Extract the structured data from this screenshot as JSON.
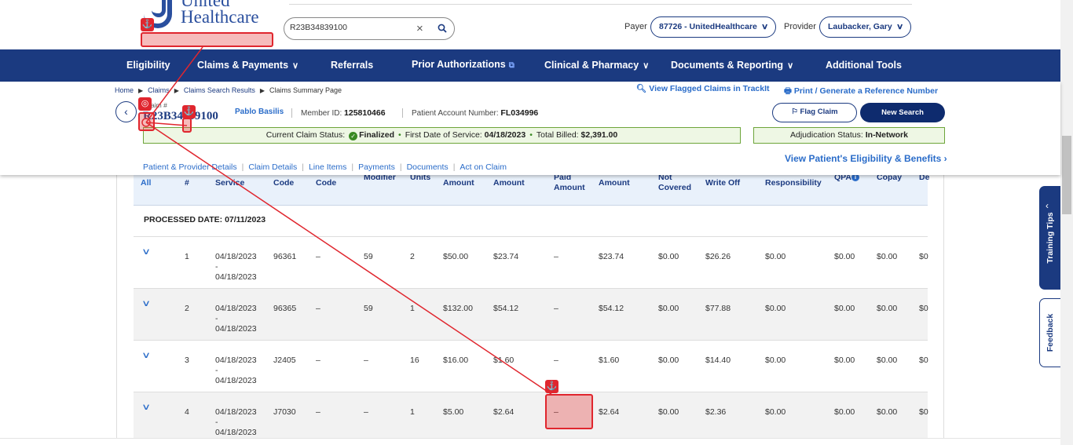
{
  "header": {
    "logo_line1": "United",
    "logo_line2": "Healthcare",
    "search_value": "R23B34839100",
    "payer_label": "Payer",
    "payer_value": "87726 - UnitedHealthcare",
    "provider_label": "Provider",
    "provider_value": "Laubacker, Gary"
  },
  "nav": {
    "items": [
      {
        "label": "Eligibility"
      },
      {
        "label": "Claims & Payments"
      },
      {
        "label": "Referrals"
      },
      {
        "label": "Prior Authorizations"
      },
      {
        "label": "Clinical & Pharmacy"
      },
      {
        "label": "Documents & Reporting"
      },
      {
        "label": "Additional Tools"
      }
    ]
  },
  "summary": {
    "breadcrumbs": [
      "Home",
      "Claims",
      "Claims Search Results",
      "Claims Summary Page"
    ],
    "flag_link": "View Flagged Claims in TrackIt",
    "print_link": "Print / Generate a Reference Number",
    "claim_label": "Claim #",
    "claim_number": "R23B34839100",
    "patient_name": "Pablo Basilis",
    "member_id_label": "Member ID:",
    "member_id": "125810466",
    "account_label": "Patient Account Number:",
    "account_number": "FL034996",
    "flag_button": "Flag Claim",
    "new_search_button": "New Search",
    "status_label": "Current Claim Status:",
    "status_value": "Finalized",
    "dos_label": "First Date of Service:",
    "dos_value": "04/18/2023",
    "billed_label": "Total Billed:",
    "billed_value": "$2,391.00",
    "adj_label": "Adjudication Status:",
    "adj_value": "In-Network",
    "eligibility_link": "View Patient's Eligibility & Benefits ›",
    "tabs": [
      "Patient & Provider Details",
      "Claim Details",
      "Line Items",
      "Payments",
      "Documents",
      "Act on Claim"
    ]
  },
  "table": {
    "headers": {
      "expand": "All",
      "line": "#",
      "service": "Service",
      "code": "Code",
      "code2": "Code",
      "modifier": "Modifier",
      "units": "Units",
      "amount1": "Amount",
      "amount2": "Amount",
      "paid": "Paid Amount",
      "allowed": "Amount",
      "not_covered": "Not Covered",
      "write_off": "Write Off",
      "responsibility": "Responsibility",
      "qpa": "QPA",
      "copay": "Copay",
      "de": "De"
    },
    "processed_date": "PROCESSED DATE: 07/11/2023",
    "rows": [
      {
        "num": "1",
        "from": "04/18/2023",
        "dash": "-",
        "to": "04/18/2023",
        "code": "96361",
        "code2": "–",
        "mod": "59",
        "units": "2",
        "amt1": "$50.00",
        "amt2": "$23.74",
        "paid": "–",
        "allowed": "$23.74",
        "notcov": "$0.00",
        "writeoff": "$26.26",
        "resp": "$0.00",
        "qpa": "$0.00",
        "copay": "$0.00",
        "de": "$0"
      },
      {
        "num": "2",
        "from": "04/18/2023",
        "dash": "-",
        "to": "04/18/2023",
        "code": "96365",
        "code2": "–",
        "mod": "59",
        "units": "1",
        "amt1": "$132.00",
        "amt2": "$54.12",
        "paid": "–",
        "allowed": "$54.12",
        "notcov": "$0.00",
        "writeoff": "$77.88",
        "resp": "$0.00",
        "qpa": "$0.00",
        "copay": "$0.00",
        "de": "$0"
      },
      {
        "num": "3",
        "from": "04/18/2023",
        "dash": "-",
        "to": "04/18/2023",
        "code": "J2405",
        "code2": "–",
        "mod": "–",
        "units": "16",
        "amt1": "$16.00",
        "amt2": "$1.60",
        "paid": "–",
        "allowed": "$1.60",
        "notcov": "$0.00",
        "writeoff": "$14.40",
        "resp": "$0.00",
        "qpa": "$0.00",
        "copay": "$0.00",
        "de": "$0"
      },
      {
        "num": "4",
        "from": "04/18/2023",
        "dash": "-",
        "to": "04/18/2023",
        "code": "J7030",
        "code2": "–",
        "mod": "–",
        "units": "1",
        "amt1": "$5.00",
        "amt2": "$2.64",
        "paid": "–",
        "allowed": "$2.64",
        "notcov": "$0.00",
        "writeoff": "$2.36",
        "resp": "$0.00",
        "qpa": "$0.00",
        "copay": "$0.00",
        "de": "$0"
      }
    ]
  },
  "side": {
    "training_tips": "Training Tips",
    "feedback": "Feedback"
  },
  "colors": {
    "brand_navy": "#1b3a80",
    "link_blue": "#2a6cc9",
    "status_green": "#3a8a23",
    "annotation_red": "#e0262e"
  }
}
